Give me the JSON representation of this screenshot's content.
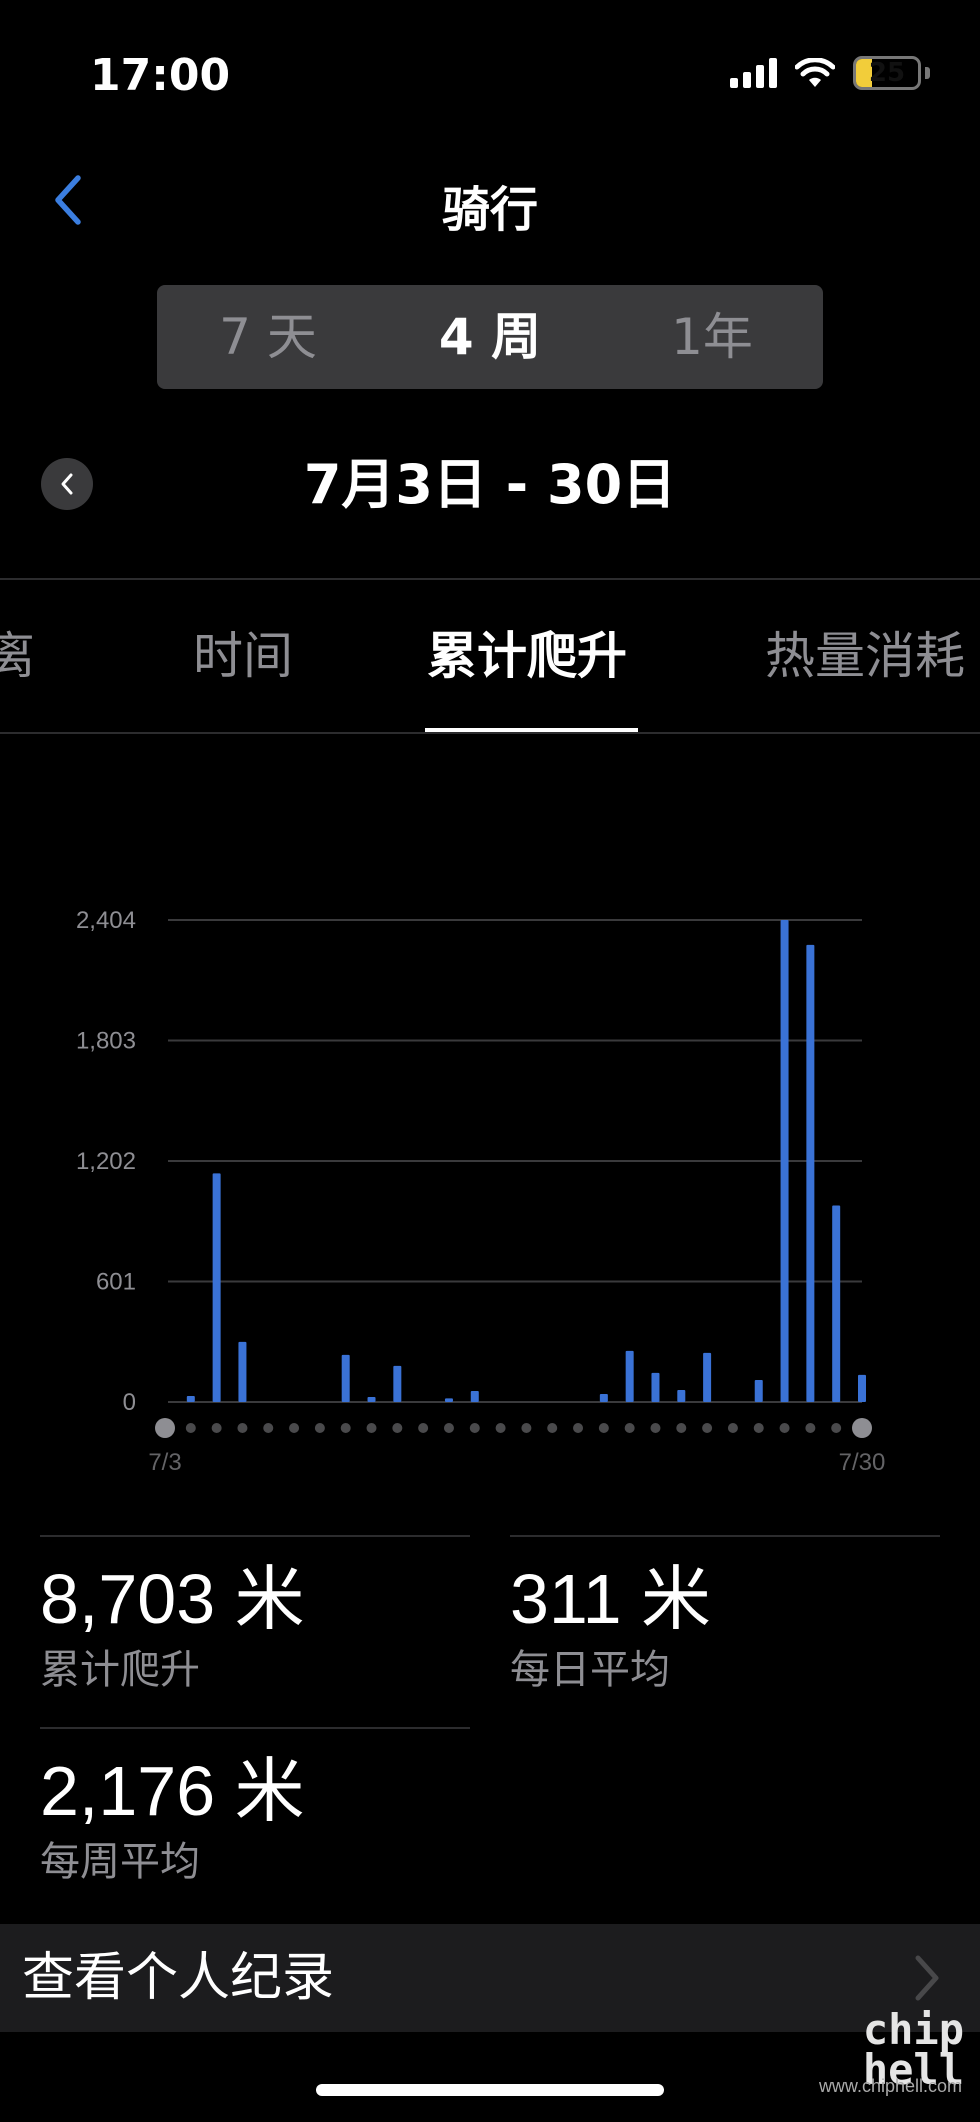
{
  "status": {
    "time": "17:00",
    "battery": "25",
    "battery_level": 0.25
  },
  "nav": {
    "title": "骑行",
    "back_icon": "chevron-left-icon"
  },
  "periods": [
    {
      "label": "7 天",
      "active": false
    },
    {
      "label": "4 周",
      "active": true
    },
    {
      "label": "1年",
      "active": false
    }
  ],
  "date_range": "7月3日 - 30日",
  "tabs": [
    {
      "label": "距离",
      "active": false
    },
    {
      "label": "时间",
      "active": false
    },
    {
      "label": "累计爬升",
      "active": true
    },
    {
      "label": "热量消耗",
      "active": false
    }
  ],
  "colors": {
    "accent": "#3b7ee0",
    "bar": "#3a72d6",
    "muted": "#8e8e93"
  },
  "chart_data": {
    "type": "bar",
    "title": "",
    "xlabel": "",
    "ylabel": "",
    "ylim": [
      0,
      2404
    ],
    "y_ticks": [
      0,
      601,
      1202,
      1803,
      2404
    ],
    "y_tick_labels": [
      "0",
      "601",
      "1,202",
      "1,803",
      "2,404"
    ],
    "x_tick_labels": [
      "7/3",
      "7/30"
    ],
    "categories": [
      "7/3",
      "7/4",
      "7/5",
      "7/6",
      "7/7",
      "7/8",
      "7/9",
      "7/10",
      "7/11",
      "7/12",
      "7/13",
      "7/14",
      "7/15",
      "7/16",
      "7/17",
      "7/18",
      "7/19",
      "7/20",
      "7/21",
      "7/22",
      "7/23",
      "7/24",
      "7/25",
      "7/26",
      "7/27",
      "7/28",
      "7/29",
      "7/30"
    ],
    "values": [
      0,
      30,
      1140,
      300,
      0,
      0,
      0,
      235,
      25,
      180,
      0,
      18,
      55,
      0,
      0,
      0,
      0,
      40,
      255,
      145,
      60,
      245,
      0,
      110,
      2404,
      2280,
      980,
      135
    ],
    "grid": true,
    "legend": "none"
  },
  "stats": [
    {
      "value": "8,703 米",
      "label": "累计爬升"
    },
    {
      "value": "311 米",
      "label": "每日平均"
    },
    {
      "value": "2,176 米",
      "label": "每周平均"
    }
  ],
  "records": {
    "label": "查看个人纪录"
  },
  "watermark": {
    "logo_line1": "chip",
    "logo_line2": "hell",
    "url": "www.chiphell.com"
  }
}
